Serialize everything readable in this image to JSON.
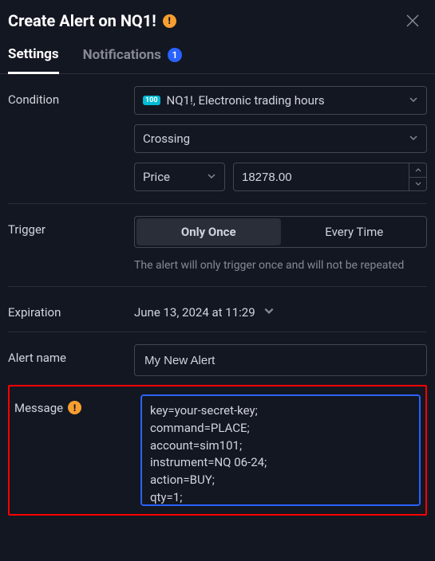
{
  "header": {
    "title": "Create Alert on NQ1!"
  },
  "tabs": {
    "settings": "Settings",
    "notifications": "Notifications",
    "notifications_count": "1"
  },
  "condition": {
    "label": "Condition",
    "symbol_badge": "100",
    "symbol_text": "NQ1!, Electronic trading hours",
    "crossing": "Crossing",
    "price_label": "Price",
    "price_value": "18278.00"
  },
  "trigger": {
    "label": "Trigger",
    "only_once": "Only Once",
    "every_time": "Every Time",
    "hint": "The alert will only trigger once and will not be repeated"
  },
  "expiration": {
    "label": "Expiration",
    "value": "June 13, 2024 at 11:29"
  },
  "alert_name": {
    "label": "Alert name",
    "value": "My New Alert"
  },
  "message": {
    "label": "Message",
    "value": "key=your-secret-key;\ncommand=PLACE;\naccount=sim101;\ninstrument=NQ 06-24;\naction=BUY;\nqty=1;"
  }
}
